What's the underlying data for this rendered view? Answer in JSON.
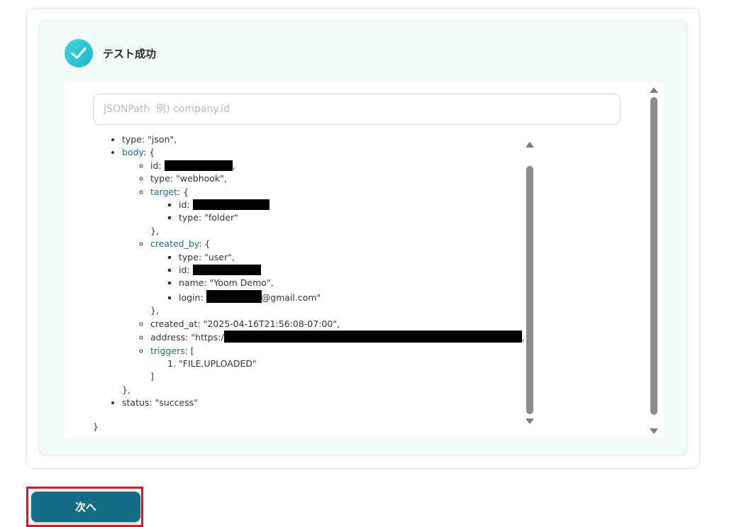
{
  "result": {
    "title": "テスト成功",
    "status_icon": "check-icon"
  },
  "search": {
    "placeholder": "JSONPath  例) company.id",
    "value": ""
  },
  "json": {
    "type_line": "type: \"json\",",
    "body_key": "body",
    "open_brace": ": {",
    "body": {
      "id_label": "id: ",
      "id_suffix": ",",
      "type_line": "type: \"webhook\",",
      "target_key": "target",
      "target": {
        "id_label": "id: ",
        "type_line": "type: \"folder\""
      },
      "target_close": "},",
      "created_by_key": "created_by",
      "created_by": {
        "type_line": "type: \"user\",",
        "id_label": "id: ",
        "name_line": "name: \"Yoom Demo\",",
        "login_label": "login: ",
        "login_suffix": "@gmail.com\""
      },
      "created_by_close": "},",
      "created_at_line": "created_at: \"2025-04-16T21:56:08-07:00\",",
      "address_label": "address: \"https:/",
      "address_suffix": ",",
      "triggers_key": "triggers",
      "triggers_open": ": [",
      "triggers": [
        "\"FILE.UPLOADED\""
      ],
      "triggers_close": "]"
    },
    "body_close": "},",
    "status_line": "status: \"success\"",
    "final_brace": "}"
  },
  "next_button": {
    "label": "次へ"
  },
  "colors": {
    "accent": "#146c85",
    "key_link": "#1d6e86",
    "success_gradient_start": "#3fd6dc",
    "success_gradient_end": "#1cb5cd",
    "highlight_border": "#e0141e"
  }
}
